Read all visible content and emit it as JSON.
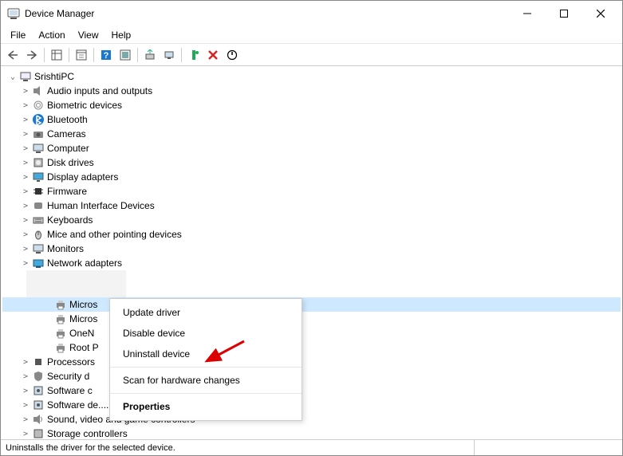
{
  "window": {
    "title": "Device Manager"
  },
  "menus": {
    "file": "File",
    "action": "Action",
    "view": "View",
    "help": "Help"
  },
  "root": {
    "name": "SrishtiPC"
  },
  "categories": [
    {
      "label": "Audio inputs and outputs",
      "icon": "speaker"
    },
    {
      "label": "Biometric devices",
      "icon": "fingerprint"
    },
    {
      "label": "Bluetooth",
      "icon": "bluetooth"
    },
    {
      "label": "Cameras",
      "icon": "camera"
    },
    {
      "label": "Computer",
      "icon": "computer"
    },
    {
      "label": "Disk drives",
      "icon": "disk"
    },
    {
      "label": "Display adapters",
      "icon": "display"
    },
    {
      "label": "Firmware",
      "icon": "chip"
    },
    {
      "label": "Human Interface Devices",
      "icon": "hid"
    },
    {
      "label": "Keyboards",
      "icon": "keyboard"
    },
    {
      "label": "Mice and other pointing devices",
      "icon": "mouse"
    },
    {
      "label": "Monitors",
      "icon": "monitor"
    },
    {
      "label": "Network adapters",
      "icon": "network"
    }
  ],
  "print_queues": {
    "items": [
      {
        "label": "Micros",
        "selected": true
      },
      {
        "label": "Micros",
        "selected": false
      },
      {
        "label": "OneN",
        "selected": false
      },
      {
        "label": "Root P",
        "selected": false
      }
    ]
  },
  "categories2": [
    {
      "label": "Processors",
      "icon": "cpu"
    },
    {
      "label": "Security d",
      "icon": "security"
    },
    {
      "label": "Software c",
      "icon": "software"
    },
    {
      "label": "Software de....",
      "icon": "software"
    },
    {
      "label": "Sound, video and game controllers",
      "icon": "sound"
    },
    {
      "label": "Storage controllers",
      "icon": "storage"
    }
  ],
  "context_menu": {
    "update": "Update driver",
    "disable": "Disable device",
    "uninstall": "Uninstall device",
    "scan": "Scan for hardware changes",
    "properties": "Properties"
  },
  "status": "Uninstalls the driver for the selected device."
}
